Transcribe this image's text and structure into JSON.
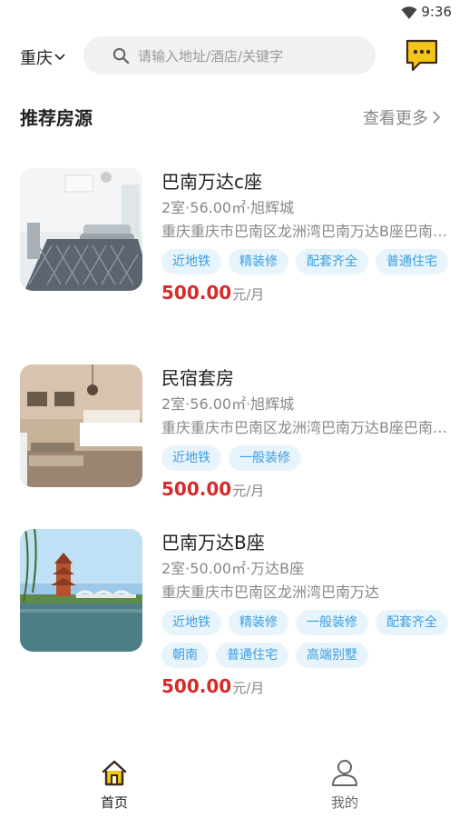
{
  "status_bar": {
    "time": "9:36"
  },
  "header": {
    "city": "重庆",
    "search_placeholder": "请输入地址/酒店/关键字"
  },
  "section": {
    "title": "推荐房源",
    "more_label": "查看更多"
  },
  "listings": [
    {
      "title": "巴南万达c座",
      "meta": "2室·56.00㎡·旭辉城",
      "address": "重庆重庆市巴南区龙洲湾巴南万达B座巴南万达B座",
      "tags": [
        "近地铁",
        "精装修",
        "配套齐全",
        "普通住宅"
      ],
      "price": "500.00",
      "unit": "元/月"
    },
    {
      "title": "民宿套房",
      "meta": "2室·56.00㎡·旭辉城",
      "address": "重庆重庆市巴南区龙洲湾巴南万达B座巴南万达B座",
      "tags": [
        "近地铁",
        "一般装修"
      ],
      "price": "500.00",
      "unit": "元/月"
    },
    {
      "title": "巴南万达B座",
      "meta": "2室·50.00㎡·万达B座",
      "address": "重庆重庆市巴南区龙洲湾巴南万达",
      "tags": [
        "近地铁",
        "精装修",
        "一般装修",
        "配套齐全",
        "朝南",
        "普通住宅",
        "高端别墅"
      ],
      "price": "500.00",
      "unit": "元/月"
    }
  ],
  "tabbar": {
    "home_label": "首页",
    "mine_label": "我的"
  },
  "colors": {
    "accent": "#f5c518",
    "price": "#d62b2b",
    "tag_bg": "#e8f4fb",
    "tag_text": "#3a9ee0"
  }
}
